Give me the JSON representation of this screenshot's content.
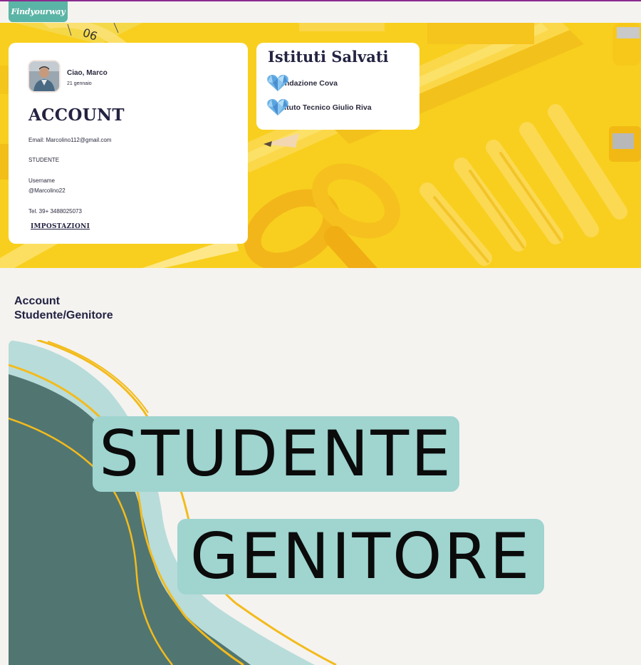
{
  "header": {
    "logo_text": "Findyourway"
  },
  "account": {
    "greeting": "Ciao, Marco",
    "date": "21 gennaio",
    "title": "ACCOUNT",
    "email": "Email: Marcolino112@gmail.com",
    "role": "STUDENTE",
    "username_label": "Username",
    "username": "@Marcolino22",
    "phone": "Tel. 39+ 3488025073",
    "settings_link": "IMPOSTAZIONI"
  },
  "saved": {
    "title": "Istituti Salvati",
    "items": [
      {
        "label": "Fondazione Cova",
        "icon": "heart-icon"
      },
      {
        "label": "Istituto Tecnico Giulio Riva",
        "icon": "heart-icon"
      }
    ]
  },
  "section": {
    "title_line1": "Account",
    "title_line2": "Studente/Genitore"
  },
  "banner": {
    "option_student": "STUDENTE",
    "option_parent": "GENITORE"
  },
  "colors": {
    "accent": "#5bb5a6",
    "hero_yellow": "#f8cf1e",
    "pill": "#9fd4cf",
    "dark_teal": "#517672",
    "text_dark": "#232342"
  }
}
